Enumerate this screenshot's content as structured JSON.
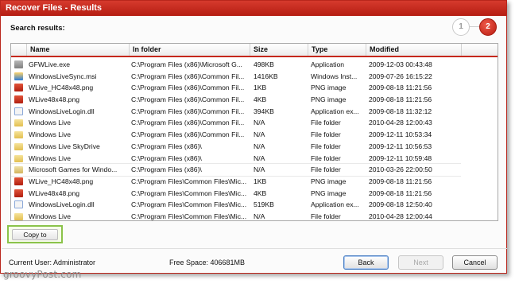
{
  "window": {
    "title": "Recover Files - Results"
  },
  "search": {
    "label": "Search results:"
  },
  "steps": [
    {
      "label": "1"
    },
    {
      "label": "2"
    }
  ],
  "table": {
    "columns": [
      "Name",
      "In folder",
      "Size",
      "Type",
      "Modified"
    ],
    "rows": [
      {
        "icon": "app-icon",
        "name": "GFWLive.exe",
        "folder": "C:\\Program Files (x86)\\Microsoft G...",
        "size": "498KB",
        "type": "Application",
        "modified": "2009-12-03 00:43:48"
      },
      {
        "icon": "msi-icon",
        "name": "WindowsLiveSync.msi",
        "folder": "C:\\Program Files (x86)\\Common Fil...",
        "size": "1416KB",
        "type": "Windows Inst...",
        "modified": "2009-07-26 16:15:22"
      },
      {
        "icon": "png-icon",
        "name": "WLive_HC48x48.png",
        "folder": "C:\\Program Files (x86)\\Common Fil...",
        "size": "1KB",
        "type": "PNG image",
        "modified": "2009-08-18 11:21:56"
      },
      {
        "icon": "png-icon",
        "name": "WLive48x48.png",
        "folder": "C:\\Program Files (x86)\\Common Fil...",
        "size": "4KB",
        "type": "PNG image",
        "modified": "2009-08-18 11:21:56"
      },
      {
        "icon": "dll-icon",
        "name": "WindowsLiveLogin.dll",
        "folder": "C:\\Program Files (x86)\\Common Fil...",
        "size": "394KB",
        "type": "Application ex...",
        "modified": "2009-08-18 11:32:12"
      },
      {
        "icon": "folder-icon",
        "name": "Windows Live",
        "folder": "C:\\Program Files (x86)\\Common Fil...",
        "size": "N/A",
        "type": "File folder",
        "modified": "2010-04-28 12:00:43"
      },
      {
        "icon": "folder-icon",
        "name": "Windows Live",
        "folder": "C:\\Program Files (x86)\\Common Fil...",
        "size": "N/A",
        "type": "File folder",
        "modified": "2009-12-11 10:53:34"
      },
      {
        "icon": "folder-icon",
        "name": "Windows Live SkyDrive",
        "folder": "C:\\Program Files (x86)\\",
        "size": "N/A",
        "type": "File folder",
        "modified": "2009-12-11 10:56:53"
      },
      {
        "icon": "folder-icon",
        "name": "Windows Live",
        "folder": "C:\\Program Files (x86)\\",
        "size": "N/A",
        "type": "File folder",
        "modified": "2009-12-11 10:59:48"
      },
      {
        "icon": "folder-open-icon",
        "name": "Microsoft Games for Windo...",
        "folder": "C:\\Program Files (x86)\\",
        "size": "N/A",
        "type": "File folder",
        "modified": "2010-03-26 22:00:50"
      },
      {
        "icon": "png-icon",
        "name": "WLive_HC48x48.png",
        "folder": "C:\\Program Files\\Common Files\\Mic...",
        "size": "1KB",
        "type": "PNG image",
        "modified": "2009-08-18 11:21:56"
      },
      {
        "icon": "png-icon",
        "name": "WLive48x48.png",
        "folder": "C:\\Program Files\\Common Files\\Mic...",
        "size": "4KB",
        "type": "PNG image",
        "modified": "2009-08-18 11:21:56"
      },
      {
        "icon": "dll-icon",
        "name": "WindowsLiveLogin.dll",
        "folder": "C:\\Program Files\\Common Files\\Mic...",
        "size": "519KB",
        "type": "Application ex...",
        "modified": "2009-08-18 12:50:40"
      },
      {
        "icon": "folder-icon",
        "name": "Windows Live",
        "folder": "C:\\Program Files\\Common Files\\Mic...",
        "size": "N/A",
        "type": "File folder",
        "modified": "2010-04-28 12:00:44"
      }
    ]
  },
  "actions": {
    "copy_to": "Copy to"
  },
  "status": {
    "user": "Current User: Administrator",
    "free_space": "Free Space: 406681MB"
  },
  "buttons": {
    "back": "Back",
    "next": "Next",
    "cancel": "Cancel"
  },
  "watermark": {
    "text": "groovyPost.com"
  },
  "colors": {
    "accent": "#c5281c",
    "highlight": "#8bc34a"
  }
}
